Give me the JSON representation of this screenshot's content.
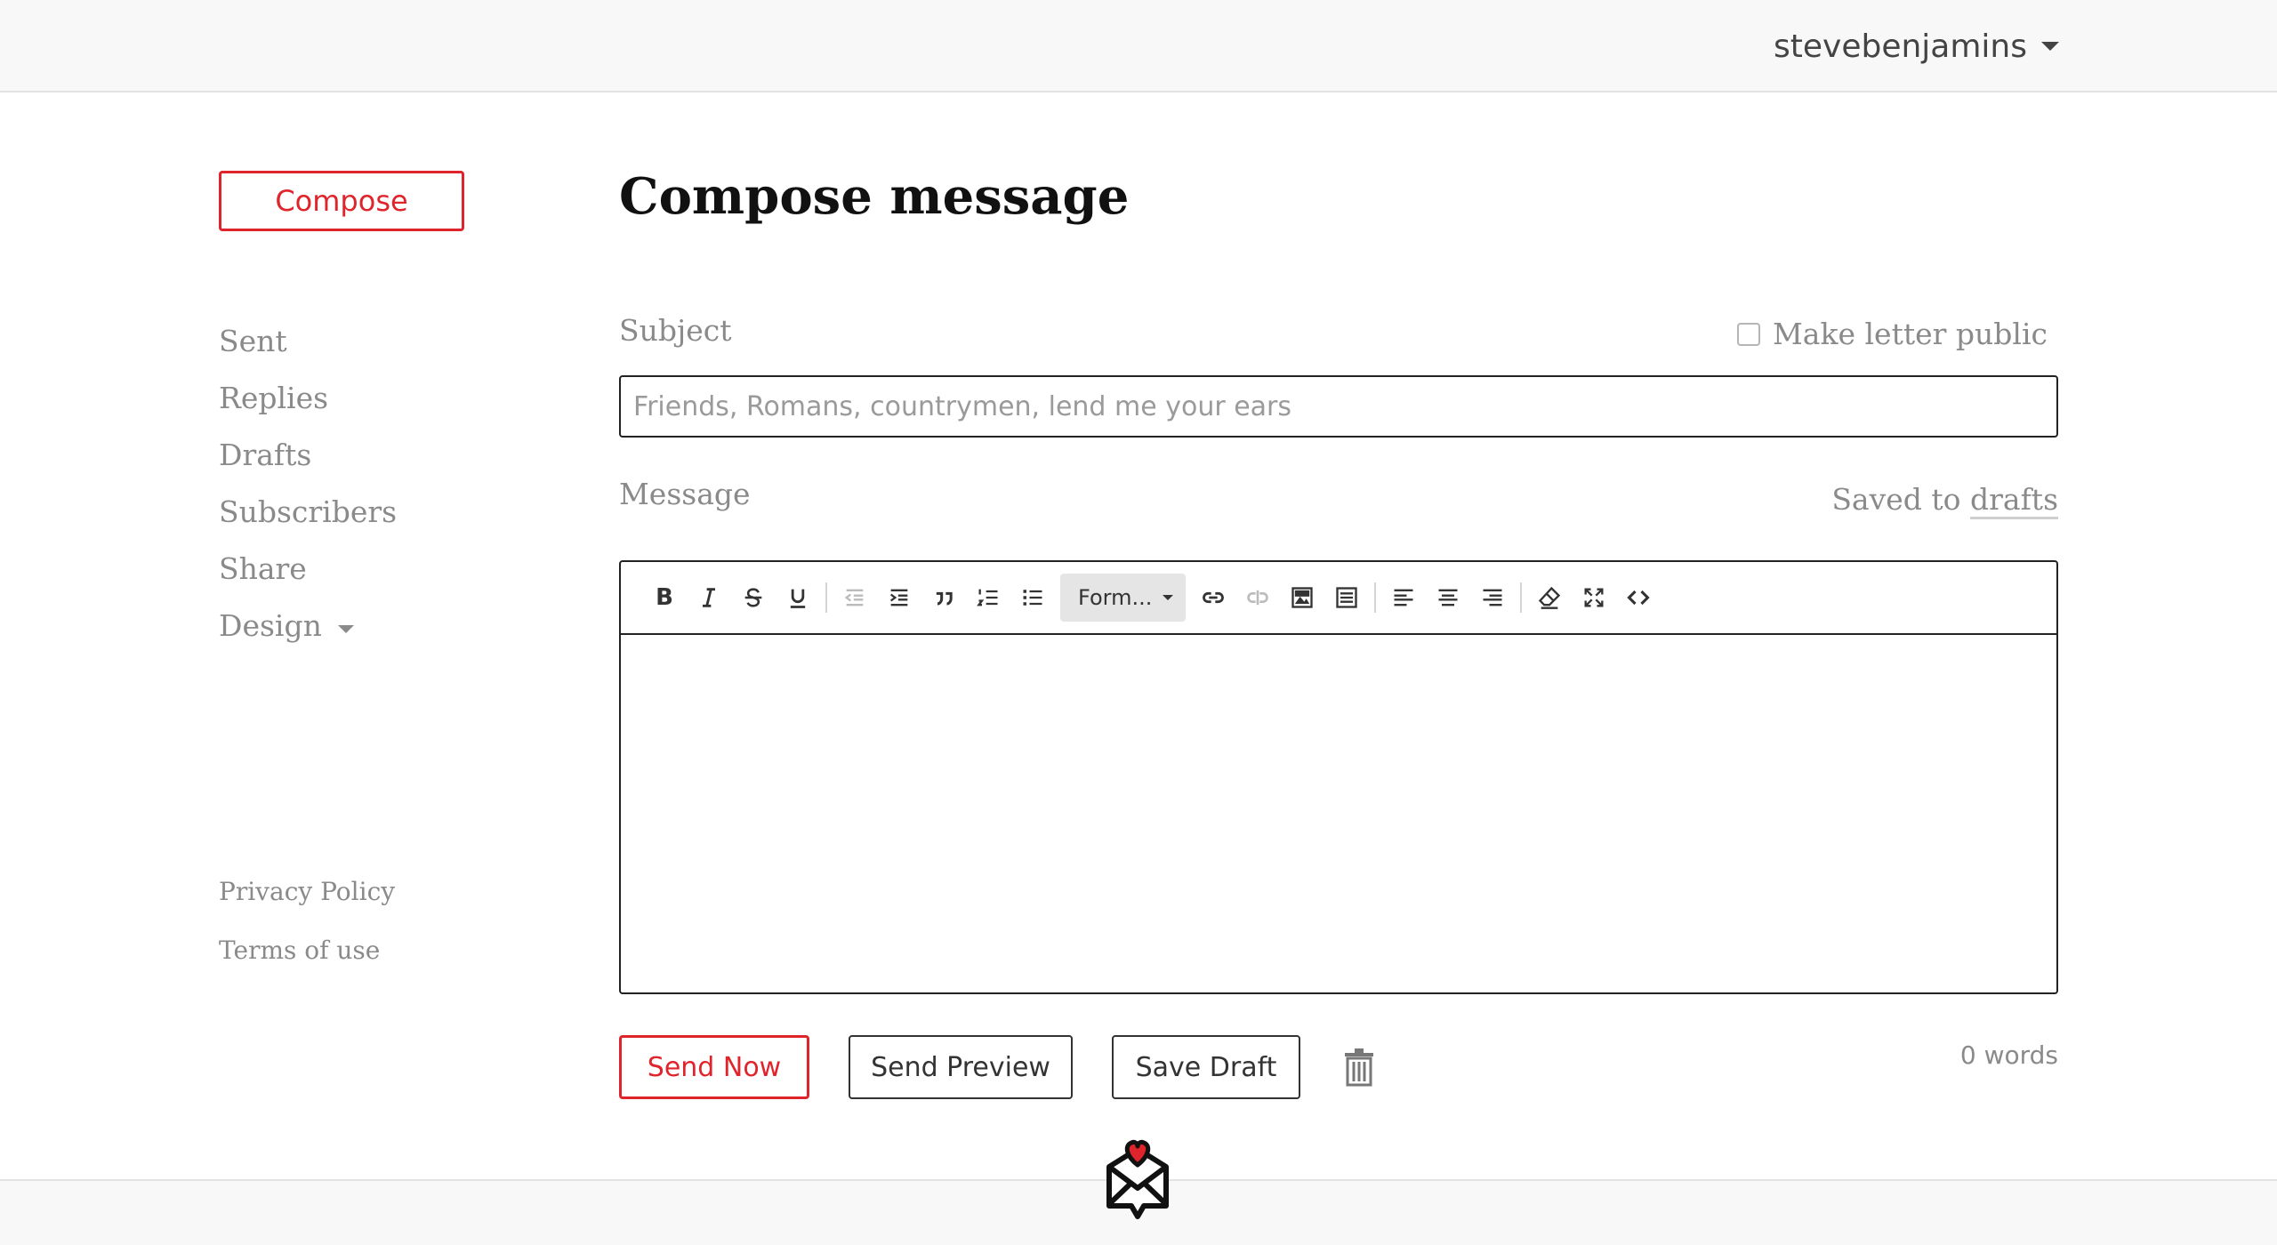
{
  "header": {
    "username": "stevebenjamins"
  },
  "sidebar": {
    "compose_label": "Compose",
    "items": [
      {
        "label": "Sent"
      },
      {
        "label": "Replies"
      },
      {
        "label": "Drafts"
      },
      {
        "label": "Subscribers"
      },
      {
        "label": "Share"
      },
      {
        "label": "Design"
      }
    ],
    "footer_links": [
      {
        "label": "Privacy Policy"
      },
      {
        "label": "Terms of use"
      }
    ]
  },
  "main": {
    "title": "Compose message",
    "subject_label": "Subject",
    "make_public_label": "Make letter public",
    "make_public_checked": false,
    "subject_value": "",
    "subject_placeholder": "Friends, Romans, countrymen, lend me your ears",
    "message_label": "Message",
    "saved_prefix": "Saved to",
    "saved_link": "drafts",
    "format_select": "Form...",
    "word_count": "0 words"
  },
  "toolbar": {
    "buttons": [
      "bold-icon",
      "italic-icon",
      "strikethrough-icon",
      "underline-icon",
      "outdent-icon",
      "indent-icon",
      "blockquote-icon",
      "ordered-list-icon",
      "bullet-list-icon",
      "format-select",
      "link-icon",
      "unlink-icon",
      "image-icon",
      "horizontal-rule-icon",
      "align-left-icon",
      "align-center-icon",
      "align-right-icon",
      "clear-format-icon",
      "fullscreen-icon",
      "code-view-icon"
    ]
  },
  "actions": {
    "send_now": "Send Now",
    "send_preview": "Send Preview",
    "save_draft": "Save Draft"
  },
  "colors": {
    "accent": "#e0242b",
    "muted_text": "#8a8a8a",
    "header_bg": "#f8f8f8"
  }
}
